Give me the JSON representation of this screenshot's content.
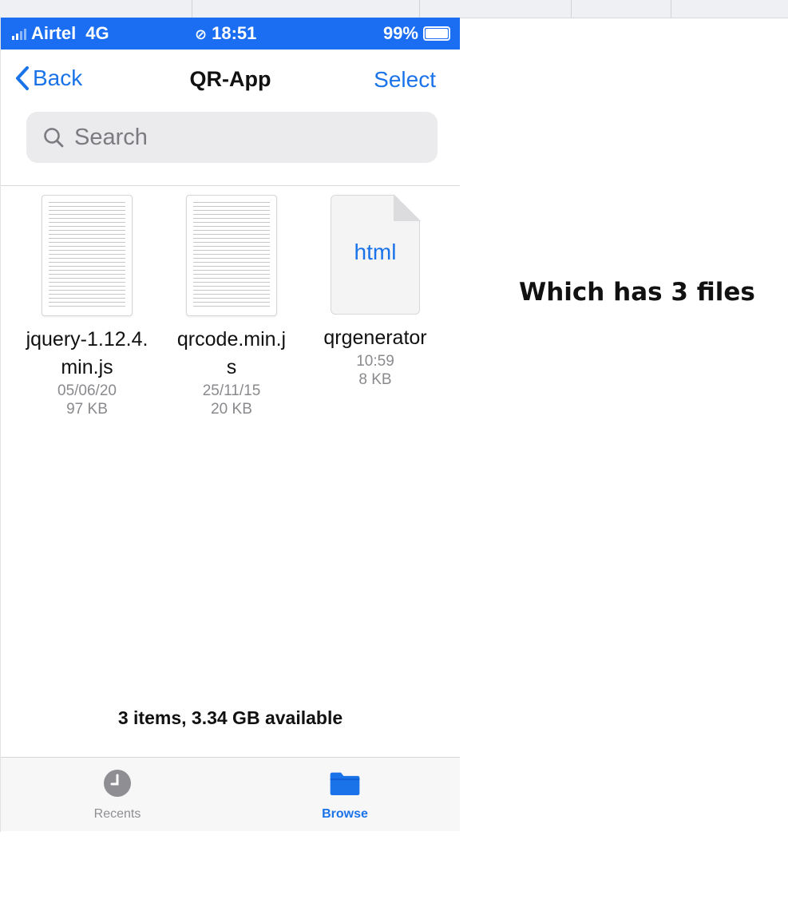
{
  "status_bar": {
    "carrier": "Airtel",
    "network": "4G",
    "time": "18:51",
    "battery": "99%"
  },
  "nav": {
    "back_label": "Back",
    "title": "QR-App",
    "select_label": "Select"
  },
  "search": {
    "placeholder": "Search"
  },
  "files": [
    {
      "name_line1": "jquery-1.12.4.",
      "name_line2": "min.js",
      "date": "05/06/20",
      "size": "97 KB",
      "icon": "text-document-thumbnail"
    },
    {
      "name_line1": "qrcode.min.j",
      "name_line2": "s",
      "date": "25/11/15",
      "size": "20 KB",
      "icon": "text-document-thumbnail"
    },
    {
      "name_line1": "qrgenerator",
      "name_line2": "",
      "date": "10:59",
      "size": "8 KB",
      "icon": "html-file-icon",
      "ext_label": "html"
    }
  ],
  "footer": {
    "summary": "3 items, 3.34 GB available"
  },
  "tabs": [
    {
      "label": "Recents",
      "icon": "clock-icon",
      "active": false
    },
    {
      "label": "Browse",
      "icon": "folder-icon",
      "active": true
    }
  ],
  "annotation": "Which has 3 files",
  "colors": {
    "accent": "#1a73e8",
    "status_bar": "#1b6ef2"
  }
}
